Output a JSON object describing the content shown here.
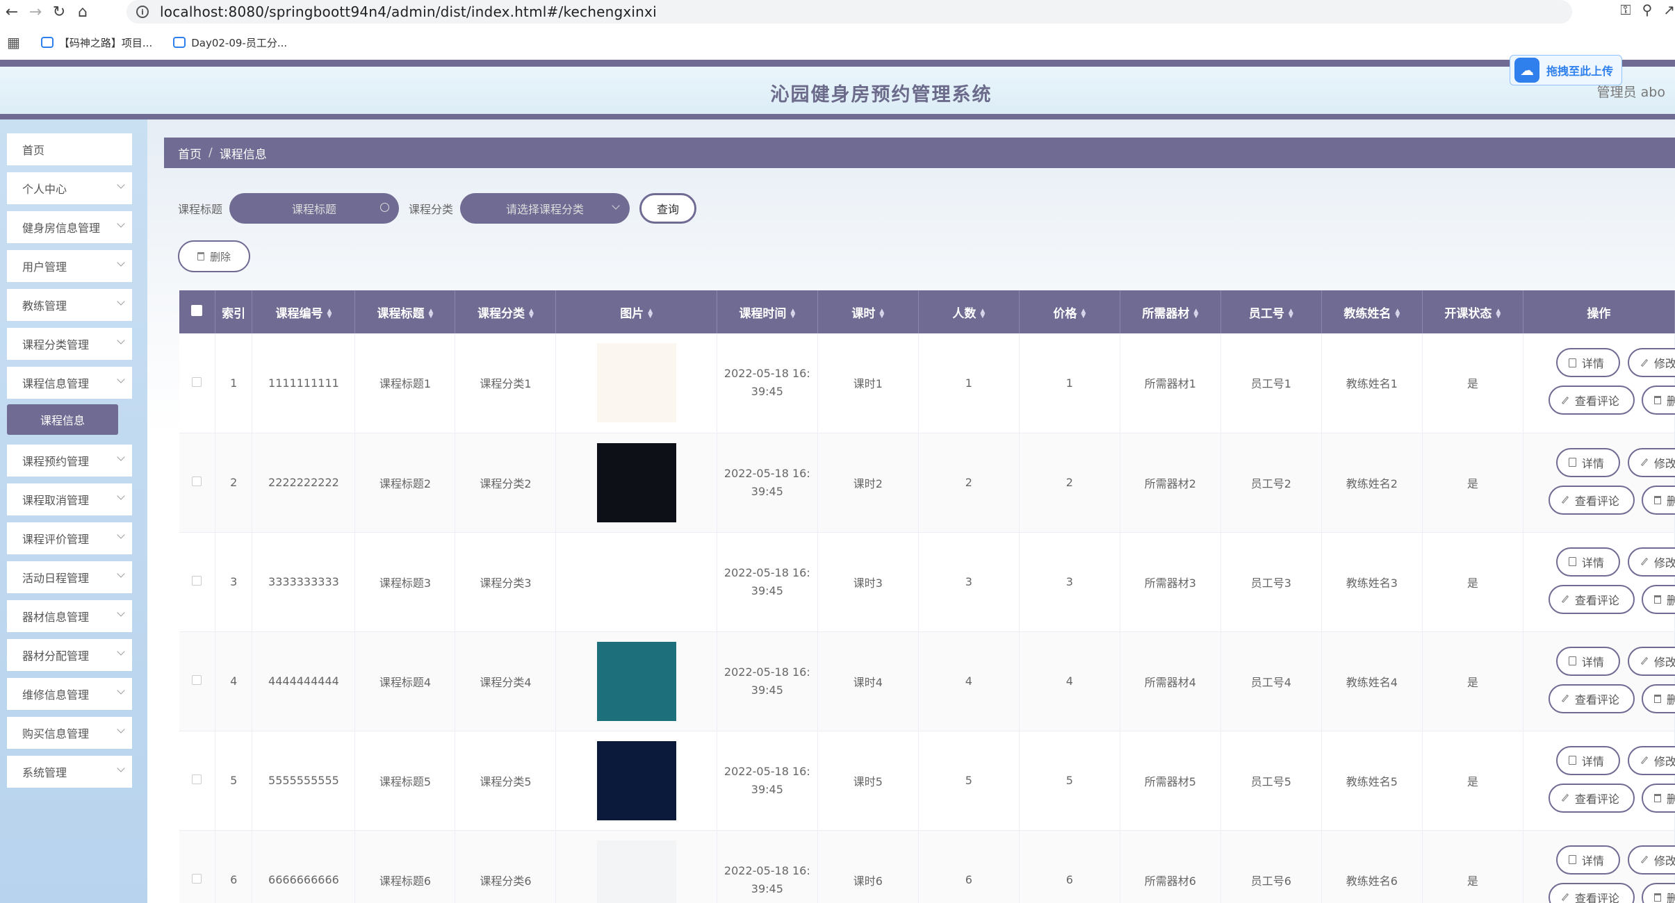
{
  "browser": {
    "url": "localhost:8080/springboott94n4/admin/dist/index.html#/kechengxinxi",
    "bookmarks": [
      "【码神之路】项目...",
      "Day02-09-员工分..."
    ]
  },
  "header": {
    "title": "沁园健身房预约管理系统",
    "admin": "管理员 abo",
    "upload_widget": "拖拽至此上传"
  },
  "sidebar": {
    "items": [
      {
        "label": "首页",
        "chevron": false
      },
      {
        "label": "个人中心",
        "chevron": true
      },
      {
        "label": "健身房信息管理",
        "chevron": true
      },
      {
        "label": "用户管理",
        "chevron": true
      },
      {
        "label": "教练管理",
        "chevron": true
      },
      {
        "label": "课程分类管理",
        "chevron": true
      },
      {
        "label": "课程信息管理",
        "chevron": true
      },
      {
        "label": "课程预约管理",
        "chevron": true
      },
      {
        "label": "课程取消管理",
        "chevron": true
      },
      {
        "label": "课程评价管理",
        "chevron": true
      },
      {
        "label": "活动日程管理",
        "chevron": true
      },
      {
        "label": "器材信息管理",
        "chevron": true
      },
      {
        "label": "器材分配管理",
        "chevron": true
      },
      {
        "label": "维修信息管理",
        "chevron": true
      },
      {
        "label": "购买信息管理",
        "chevron": true
      },
      {
        "label": "系统管理",
        "chevron": true
      }
    ],
    "active_sub": "课程信息"
  },
  "breadcrumb": {
    "home": "首页",
    "separator": "/",
    "current": "课程信息"
  },
  "search": {
    "title_label": "课程标题",
    "title_placeholder": "课程标题",
    "category_label": "课程分类",
    "category_placeholder": "请选择课程分类",
    "query_button": "查询"
  },
  "toolbar": {
    "delete_button": "删除"
  },
  "table": {
    "columns": [
      "索引",
      "课程编号",
      "课程标题",
      "课程分类",
      "图片",
      "课程时间",
      "课时",
      "人数",
      "价格",
      "所需器材",
      "员工号",
      "教练姓名",
      "开课状态",
      "操作"
    ],
    "buttons": {
      "detail": "详情",
      "edit": "修改",
      "comments": "查看评论",
      "delete": "删除"
    },
    "rows": [
      {
        "index": "1",
        "code": "1111111111",
        "title": "课程标题1",
        "category": "课程分类1",
        "image": "people-computer-image",
        "time_line1": "2022-05-18 16:",
        "time_line2": "39:45",
        "hours": "课时1",
        "people": "1",
        "price": "1",
        "equipment": "所需器材1",
        "staff_no": "员工号1",
        "coach": "教练姓名1",
        "status": "是"
      },
      {
        "index": "2",
        "code": "2222222222",
        "title": "课程标题2",
        "category": "课程分类2",
        "image": "mysql-logo-image",
        "time_line1": "2022-05-18 16:",
        "time_line2": "39:45",
        "hours": "课时2",
        "people": "2",
        "price": "2",
        "equipment": "所需器材2",
        "staff_no": "员工号2",
        "coach": "教练姓名2",
        "status": "是"
      },
      {
        "index": "3",
        "code": "3333333333",
        "title": "课程标题3",
        "category": "课程分类3",
        "image": "sql-server-logo-image",
        "time_line1": "2022-05-18 16:",
        "time_line2": "39:45",
        "hours": "课时3",
        "people": "3",
        "price": "3",
        "equipment": "所需器材3",
        "staff_no": "员工号3",
        "coach": "教练姓名3",
        "status": "是"
      },
      {
        "index": "4",
        "code": "4444444444",
        "title": "课程标题4",
        "category": "课程分类4",
        "image": "idea-lightbulb-image",
        "time_line1": "2022-05-18 16:",
        "time_line2": "39:45",
        "hours": "课时4",
        "people": "4",
        "price": "4",
        "equipment": "所需器材4",
        "staff_no": "员工号4",
        "coach": "教练姓名4",
        "status": "是"
      },
      {
        "index": "5",
        "code": "5555555555",
        "title": "课程标题5",
        "category": "课程分类5",
        "image": "digital-head-image",
        "time_line1": "2022-05-18 16:",
        "time_line2": "39:45",
        "hours": "课时5",
        "people": "5",
        "price": "5",
        "equipment": "所需器材5",
        "staff_no": "员工号5",
        "coach": "教练姓名5",
        "status": "是"
      },
      {
        "index": "6",
        "code": "6666666666",
        "title": "课程标题6",
        "category": "课程分类6",
        "image": "office-desk-image",
        "time_line1": "2022-05-18 16:",
        "time_line2": "39:45",
        "hours": "课时6",
        "people": "6",
        "price": "6",
        "equipment": "所需器材6",
        "staff_no": "员工号6",
        "coach": "教练姓名6",
        "status": "是"
      }
    ]
  },
  "colors": {
    "accent": "#6f6b92",
    "sidebar": "#c9dff2",
    "header": "#eaf5fb"
  }
}
